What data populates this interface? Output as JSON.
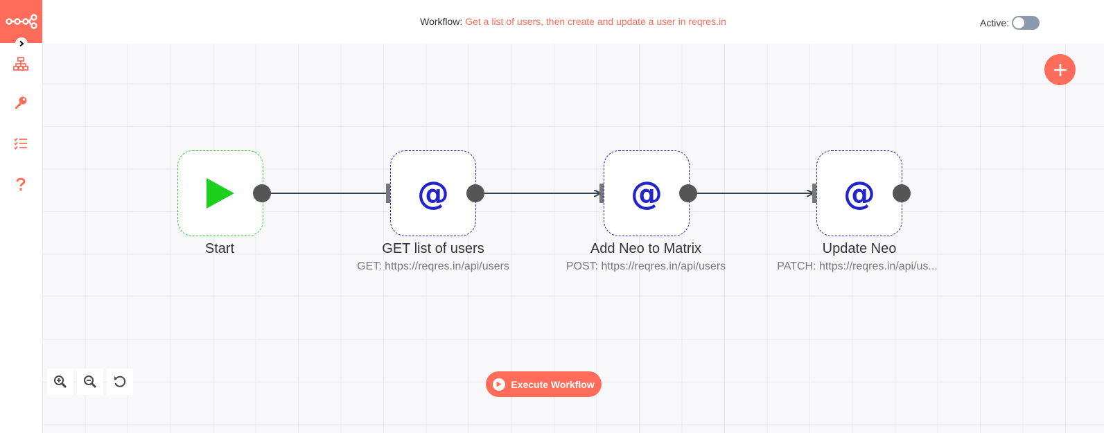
{
  "header": {
    "workflow_label": "Workflow:",
    "workflow_name": "Get a list of users, then create and update a user in reqres.in",
    "active_label": "Active:",
    "active": false
  },
  "sidebar": {
    "items": [
      {
        "icon": "network-icon"
      },
      {
        "icon": "key-icon"
      },
      {
        "icon": "list-icon"
      },
      {
        "icon": "help-icon"
      }
    ]
  },
  "nodes": [
    {
      "name": "Start",
      "subtitle": "",
      "icon": "play-icon"
    },
    {
      "name": "GET list of users",
      "subtitle": "GET: https://reqres.in/api/users",
      "icon": "at-icon",
      "glyph": "@"
    },
    {
      "name": "Add Neo to Matrix",
      "subtitle": "POST: https://reqres.in/api/users",
      "icon": "at-icon",
      "glyph": "@"
    },
    {
      "name": "Update Neo",
      "subtitle": "PATCH: https://reqres.in/api/us...",
      "icon": "at-icon",
      "glyph": "@"
    }
  ],
  "controls": {
    "execute_label": "Execute Workflow"
  },
  "colors": {
    "accent": "#ff6d5a",
    "start_node_border": "#20d020",
    "http_node_border": "#2020c0",
    "http_icon": "#2323cc",
    "start_icon": "#1ed01e",
    "connector": "#555555",
    "edge": "#33404d"
  }
}
